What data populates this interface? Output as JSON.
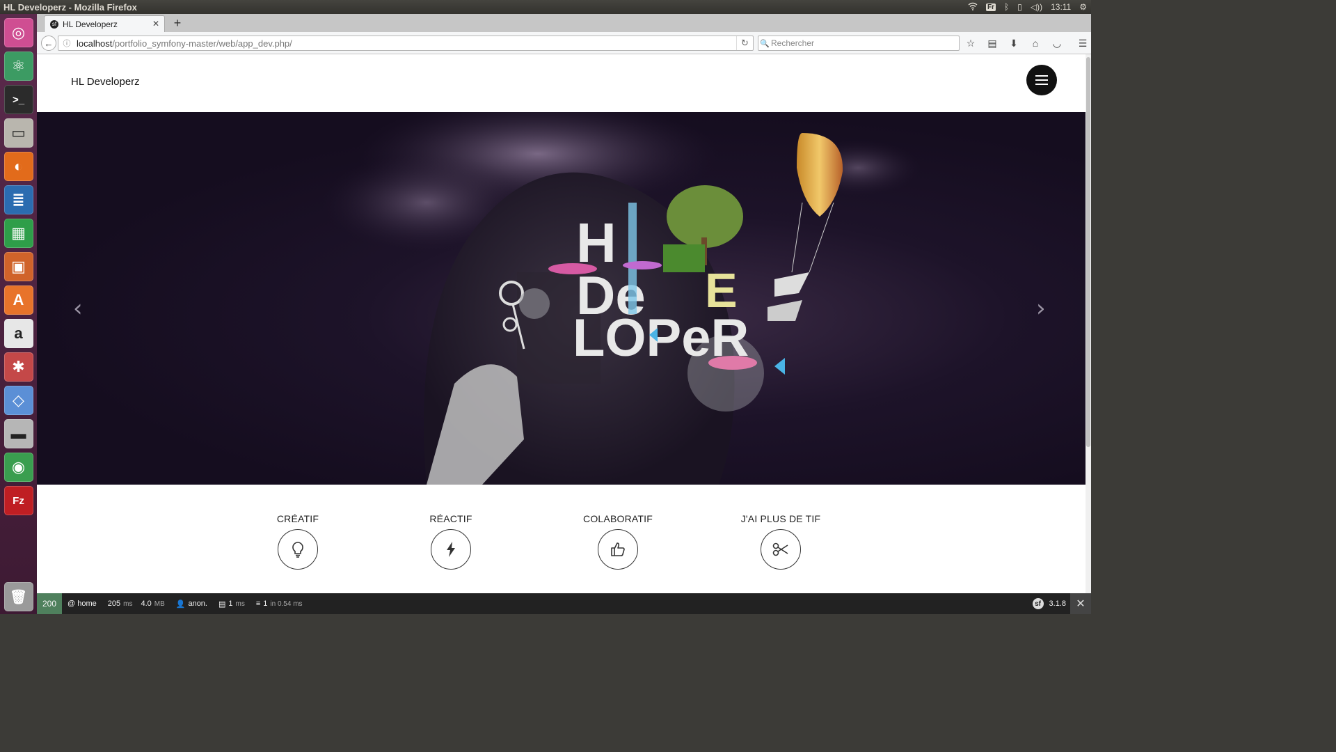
{
  "os": {
    "window_title": "HL Developerz - Mozilla Firefox",
    "tray": {
      "keyboard": "Fr",
      "time": "13:11"
    },
    "launcher": [
      {
        "name": "ubuntu-dash-icon",
        "glyph": "◎",
        "color": "#cf4e92"
      },
      {
        "name": "atom-icon",
        "glyph": "⚛",
        "color": "#3c9b63"
      },
      {
        "name": "terminal-icon",
        "glyph": ">_",
        "color": "#2b2b2b"
      },
      {
        "name": "files-icon",
        "glyph": "▭",
        "color": "#b9b6ae"
      },
      {
        "name": "firefox-icon",
        "glyph": "◐",
        "color": "#e26b1b"
      },
      {
        "name": "writer-icon",
        "glyph": "≣",
        "color": "#2b6cb0"
      },
      {
        "name": "calc-icon",
        "glyph": "▦",
        "color": "#2e9e49"
      },
      {
        "name": "impress-icon",
        "glyph": "▣",
        "color": "#d0632a"
      },
      {
        "name": "software-center-icon",
        "glyph": "A",
        "color": "#e8732a"
      },
      {
        "name": "amazon-icon",
        "glyph": "a",
        "color": "#e7e7e7"
      },
      {
        "name": "system-settings-icon",
        "glyph": "✱",
        "color": "#c44848"
      },
      {
        "name": "virtualbox-icon",
        "glyph": "◇",
        "color": "#5b8fd6"
      },
      {
        "name": "disk-icon",
        "glyph": "▬",
        "color": "#b6b6b6"
      },
      {
        "name": "chrome-icon",
        "glyph": "◉",
        "color": "#3a9e4f"
      },
      {
        "name": "filezilla-icon",
        "glyph": "Fz",
        "color": "#bf1e23"
      }
    ]
  },
  "browser": {
    "tab_title": "HL Developerz",
    "url_host": "localhost",
    "url_path": "/portfolio_symfony-master/web/app_dev.php/",
    "search_placeholder": "Rechercher"
  },
  "site": {
    "brand": "HL Developerz",
    "features": [
      {
        "label": "CRÉATIF",
        "icon": "lightbulb-icon"
      },
      {
        "label": "RÉACTIF",
        "icon": "lightning-icon"
      },
      {
        "label": "COLABORATIF",
        "icon": "thumbs-up-icon"
      },
      {
        "label": "J'AI PLUS DE TIF",
        "icon": "scissors-icon"
      }
    ]
  },
  "profiler": {
    "status": "200",
    "route": "@ home",
    "time_value": "205",
    "time_unit": "ms",
    "memory_value": "4.0",
    "memory_unit": "MB",
    "user": "anon.",
    "twig_value": "1",
    "twig_unit": "ms",
    "db_value": "1",
    "db_detail": "in 0.54 ms",
    "symfony_version": "3.1.8"
  }
}
